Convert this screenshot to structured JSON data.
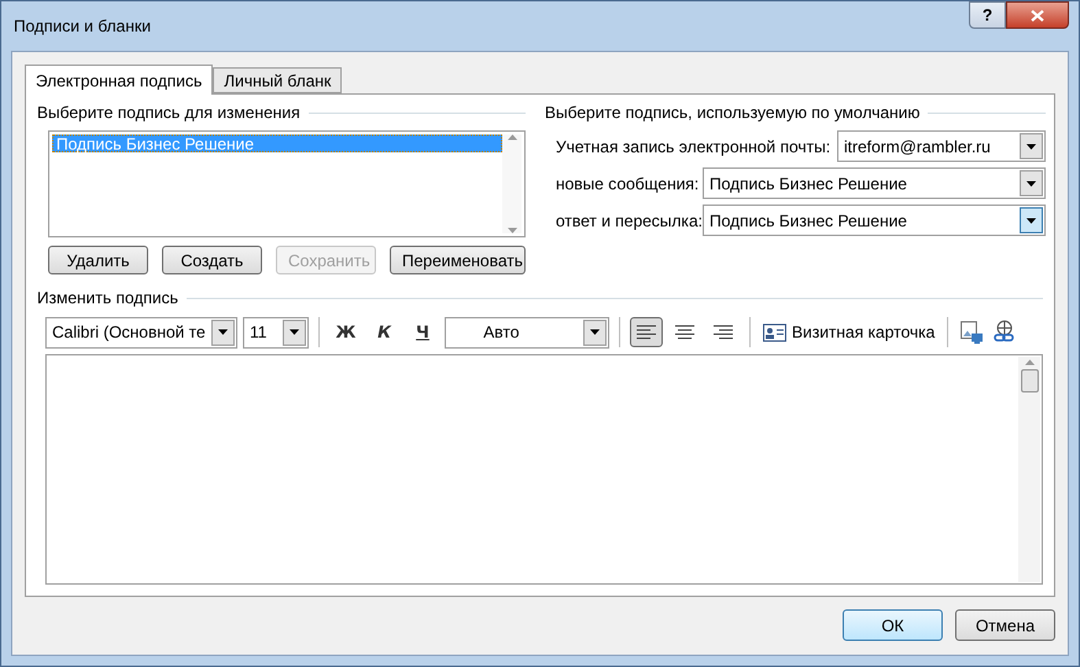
{
  "window": {
    "title": "Подписи и бланки",
    "help": "?"
  },
  "tabs": [
    {
      "label": "Электронная подпись",
      "selected": true
    },
    {
      "label": "Личный бланк",
      "selected": false
    }
  ],
  "select_signature": {
    "heading": "Выберите подпись для изменения",
    "items": [
      {
        "label": "Подпись Бизнес Решение",
        "selected": true
      }
    ],
    "buttons": [
      {
        "label": "Удалить",
        "disabled": false
      },
      {
        "label": "Создать",
        "disabled": false
      },
      {
        "label": "Сохранить",
        "disabled": true
      },
      {
        "label": "Переименовать",
        "disabled": false
      }
    ]
  },
  "default_signature": {
    "heading": "Выберите подпись, используемую по умолчанию",
    "fields": [
      {
        "label": "Учетная запись электронной почты:",
        "value": "itreform@rambler.ru",
        "focused": false
      },
      {
        "label": "новые сообщения:",
        "value": "Подпись Бизнес Решение",
        "focused": false
      },
      {
        "label": "ответ и пересылка:",
        "value": "Подпись Бизнес Решение",
        "focused": true
      }
    ]
  },
  "edit_signature": {
    "heading": "Изменить подпись",
    "toolbar": {
      "font": "Calibri (Основной те",
      "size": "11",
      "bold": "Ж",
      "italic": "К",
      "underline": "Ч",
      "color_label": "Авто",
      "align": [
        {
          "kind": "left",
          "selected": true
        },
        {
          "kind": "center",
          "selected": false
        },
        {
          "kind": "right",
          "selected": false
        }
      ],
      "business_card": "Визитная карточка"
    }
  },
  "buttons": [
    {
      "label": "ОК",
      "default": true
    },
    {
      "label": "Отмена",
      "default": false
    }
  ]
}
